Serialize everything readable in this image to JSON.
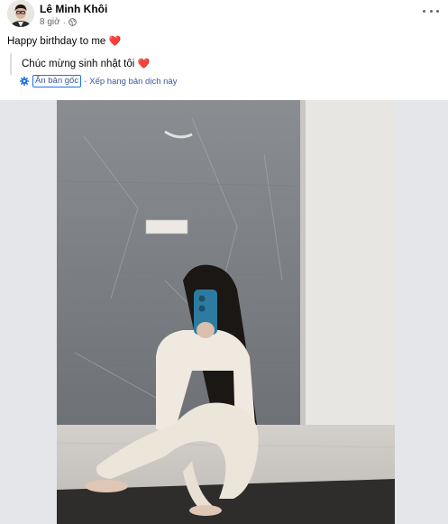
{
  "post": {
    "author": "Lê Minh Khôi",
    "time": "8 giờ",
    "privacy_icon": "globe-icon",
    "more_icon": "more-options-icon",
    "text": "Happy birthday to me",
    "text_emoji": "❤️",
    "translation": {
      "text": "Chúc mừng sinh nhật tôi",
      "emoji": "❤️",
      "settings_icon": "gear-icon",
      "show_original_label": "Ẩn bản gốc",
      "separator": "·",
      "rate_label": "Xếp hạng bản dịch này"
    }
  },
  "colors": {
    "link": "#385898",
    "focus_ring": "#1b74e4",
    "secondary_text": "#65676b",
    "photo_background": "#e4e6ea",
    "heart": "#e41e3f"
  }
}
